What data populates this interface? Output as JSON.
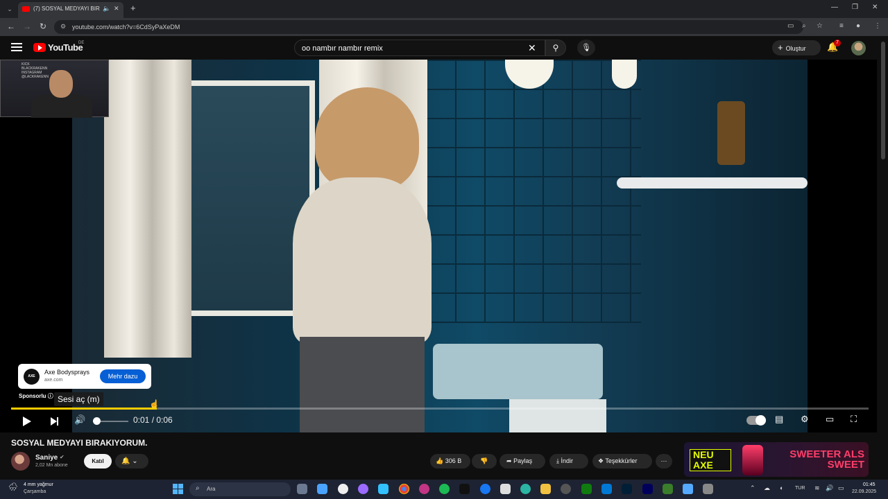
{
  "browser": {
    "tab_title": "(7) SOSYAL MEDYAYI BIRAK",
    "url": "youtube.com/watch?v=6CdSyPaXeDM"
  },
  "youtube": {
    "logo_text": "YouTube",
    "country": "DE",
    "search_query": "oo nambır nambır remix",
    "create_label": "Oluştur",
    "notification_count": "7"
  },
  "facecam": {
    "kick": "KICK",
    "handle1": "BLACKRAKENN",
    "insta": "INSTAGRAM",
    "handle2": "@LACKRAKENN"
  },
  "ad_overlay": {
    "logo": "AXE",
    "name": "Axe Bodysprays",
    "domain": "axe.com",
    "cta": "Mehr dazu",
    "sponsor_label": "Sponsorlu"
  },
  "player": {
    "tooltip": "Sesi aç (m)",
    "time": "0:01 / 0:06",
    "progress": 0.17
  },
  "video": {
    "title": "SOSYAL MEDYAYI BIRAKIYORUM.",
    "channel": "Saniye",
    "subscribers": "2,02 Mn abone",
    "join_label": "Katıl",
    "likes": "306 B",
    "share_label": "Paylaş",
    "download_label": "İndir",
    "thanks_label": "Teşekkürler"
  },
  "ad_banner": {
    "left": "NEU AXE",
    "right": "SWEETER ALS SWEET"
  },
  "taskbar": {
    "weather_temp": "4 mm yağmur",
    "weather_day": "Çarşamba",
    "search_label": "Ara",
    "lang": "TUR",
    "time": "01:45",
    "date": "22.09.2025"
  }
}
